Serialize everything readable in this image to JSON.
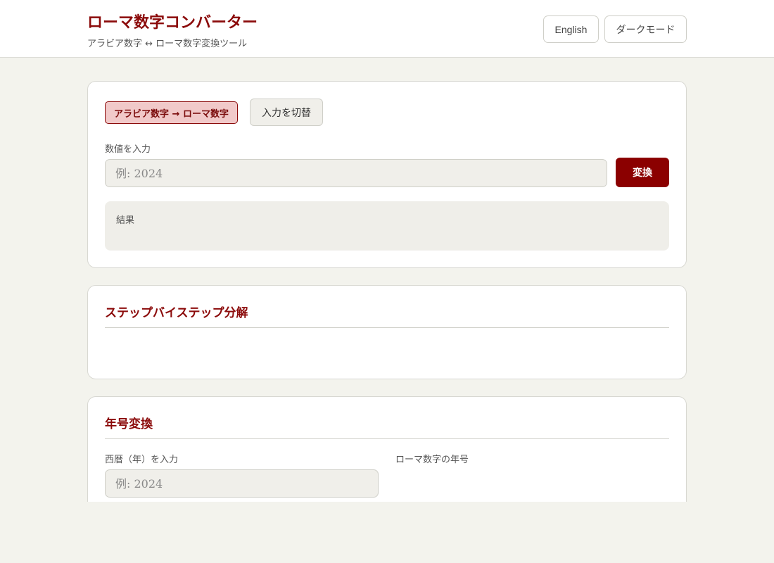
{
  "header": {
    "title": "ローマ数字コンバーター",
    "subtitle": "アラビア数字 ↔ ローマ数字変換ツール",
    "language_button": "English",
    "dark_mode_button": "ダークモード"
  },
  "converter": {
    "mode_label": "アラビア数字 → ローマ数字",
    "swap_button": "入力を切替",
    "input_label": "数値を入力",
    "input_placeholder": "例: 2024",
    "input_value": "",
    "convert_button": "変換",
    "result_label": "結果",
    "result_value": ""
  },
  "breakdown": {
    "title": "ステップバイステップ分解"
  },
  "year": {
    "title": "年号変換",
    "input_label": "西暦（年）を入力",
    "input_placeholder": "例: 2024",
    "output_label": "ローマ数字の年号"
  },
  "colors": {
    "accent": "#8b0000",
    "background": "#f3f3ed",
    "pill_bg": "#f1c9c9"
  }
}
